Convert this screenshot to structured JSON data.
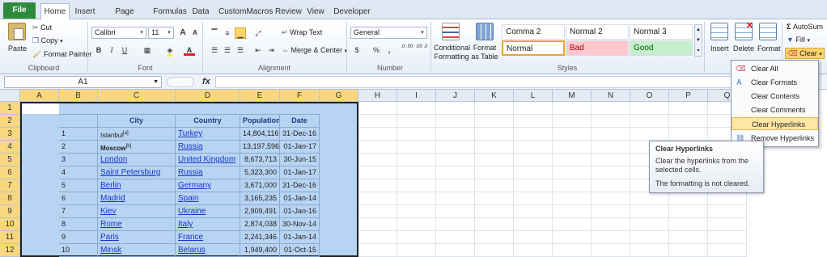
{
  "tabs": [
    "File",
    "Home",
    "Insert",
    "Page Layout",
    "Formulas",
    "Data",
    "CustomMacros",
    "Review",
    "View",
    "Developer"
  ],
  "clipboard": {
    "paste": "Paste",
    "cut": "Cut",
    "copy": "Copy",
    "format_painter": "Format Painter",
    "group": "Clipboard"
  },
  "font": {
    "name": "Calibri",
    "size": "11",
    "bold": "B",
    "italic": "I",
    "underline": "U",
    "grow": "A",
    "shrink": "A",
    "font_color": "A",
    "group": "Font"
  },
  "alignment": {
    "wrap_text": "Wrap Text",
    "merge_center": "Merge & Center",
    "group": "Alignment"
  },
  "number": {
    "format": "General",
    "currency": "$",
    "percent": "%",
    "comma": ",",
    "inc_dec": ".0 .00",
    "dec_dec": ".00 .0",
    "group": "Number"
  },
  "styles": {
    "conditional_formatting": "Conditional Formatting",
    "format_as_table": "Format as Table",
    "cells": [
      {
        "label": "Comma 2"
      },
      {
        "label": "Normal 2"
      },
      {
        "label": "Normal 3"
      },
      {
        "label": "Normal"
      },
      {
        "label": "Bad"
      },
      {
        "label": "Good"
      }
    ],
    "group": "Styles"
  },
  "cells_group": {
    "insert": "Insert",
    "delete": "Delete",
    "format": "Format"
  },
  "editing": {
    "autosum": "AutoSum",
    "fill": "Fill",
    "clear": "Clear"
  },
  "formula_bar": {
    "namebox": "A1",
    "fx": "fx"
  },
  "columns": [
    "A",
    "B",
    "C",
    "D",
    "E",
    "F",
    "G",
    "H",
    "I",
    "J",
    "K",
    "L",
    "M",
    "N",
    "O",
    "P",
    "Q"
  ],
  "rows": [
    "1",
    "2",
    "3",
    "4",
    "5",
    "6",
    "7",
    "8",
    "9",
    "10",
    "11",
    "12"
  ],
  "table": {
    "headers": [
      "City",
      "Country",
      "Population",
      "Date"
    ],
    "rows": [
      {
        "n": "1",
        "city": "Istanbul",
        "city_sup": "[a]",
        "country": "Turkey",
        "pop": "14,804,116",
        "date": "31-Dec-16"
      },
      {
        "n": "2",
        "city": "Moscow",
        "city_sup": "[b]",
        "country": "Russia",
        "pop": "13,197,596",
        "date": "01-Jan-17"
      },
      {
        "n": "3",
        "city": "London",
        "city_sup": "",
        "country": "United Kingdom",
        "pop": "8,673,713",
        "date": "30-Jun-15"
      },
      {
        "n": "4",
        "city": "Saint Petersburg",
        "city_sup": "",
        "country": "Russia",
        "pop": "5,323,300",
        "date": "01-Jan-17"
      },
      {
        "n": "5",
        "city": "Berlin",
        "city_sup": "",
        "country": "Germany",
        "pop": "3,671,000",
        "date": "31-Dec-16"
      },
      {
        "n": "6",
        "city": "Madrid",
        "city_sup": "",
        "country": "Spain",
        "pop": "3,165,235",
        "date": "01-Jan-14"
      },
      {
        "n": "7",
        "city": "Kiev",
        "city_sup": "",
        "country": "Ukraine",
        "pop": "2,909,491",
        "date": "01-Jan-16"
      },
      {
        "n": "8",
        "city": "Rome",
        "city_sup": "",
        "country": "Italy",
        "pop": "2,874,038",
        "date": "30-Nov-14"
      },
      {
        "n": "9",
        "city": "Paris",
        "city_sup": "",
        "country": "France",
        "pop": "2,241,346",
        "date": "01-Jan-14"
      },
      {
        "n": "10",
        "city": "Minsk",
        "city_sup": "",
        "country": "Belarus",
        "pop": "1,949,400",
        "date": "01-Oct-15"
      }
    ]
  },
  "clear_menu": [
    "Clear All",
    "Clear Formats",
    "Clear Contents",
    "Clear Comments",
    "Clear Hyperlinks",
    "Remove Hyperlinks"
  ],
  "tooltip": {
    "title": "Clear Hyperlinks",
    "line1": "Clear the hyperlinks from the selected cells.",
    "line2": "The formatting is not cleared."
  },
  "colors": {
    "selection": "#b8d4f3",
    "highlight": "#fde6a6",
    "file_tab": "#2e8b3e",
    "link": "#1535c8"
  }
}
